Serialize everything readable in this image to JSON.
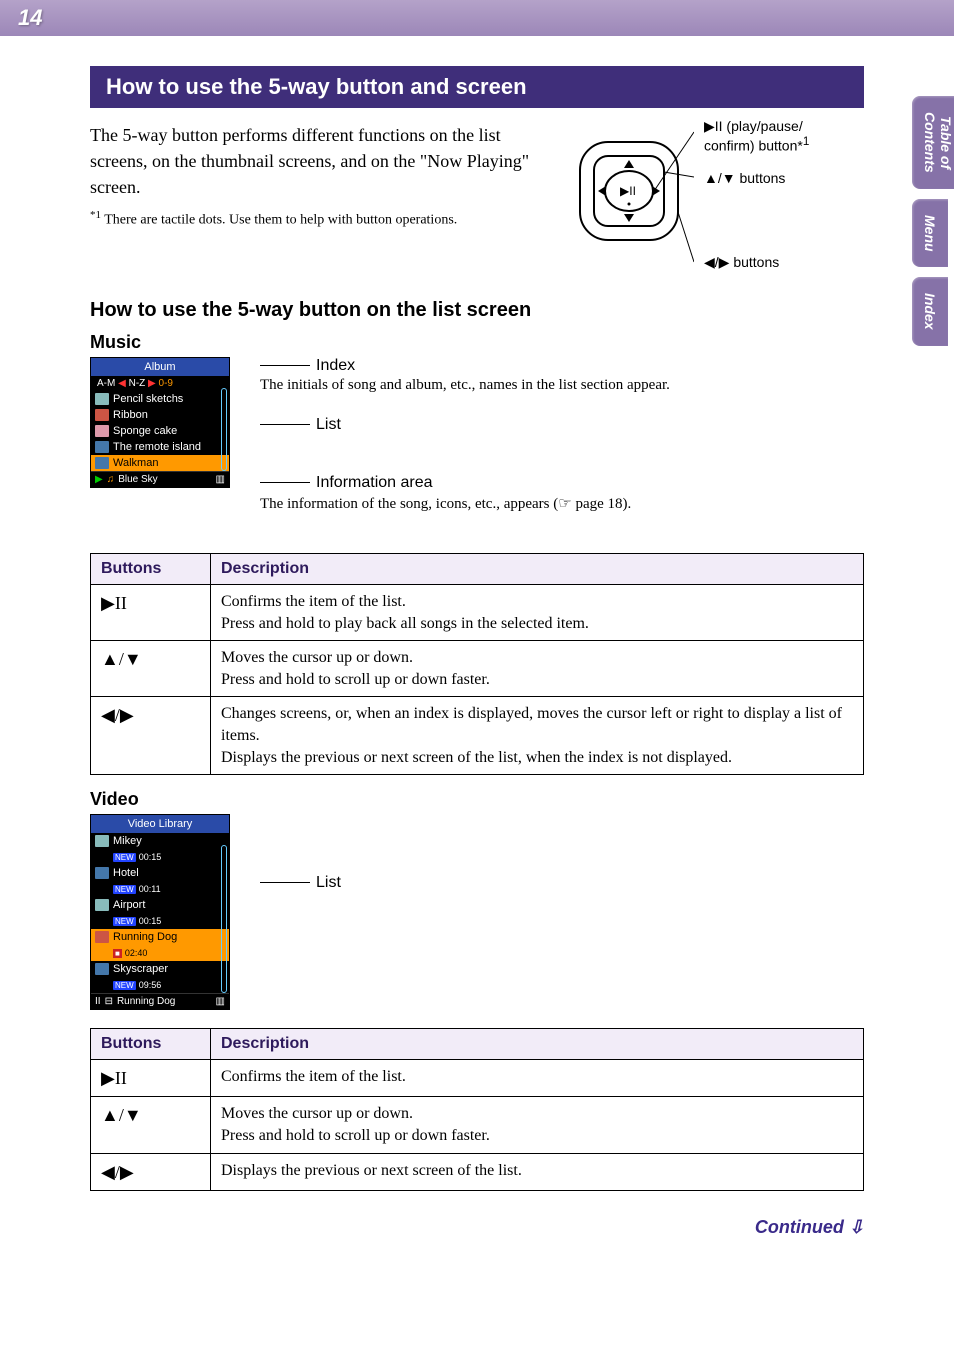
{
  "page_number": "14",
  "side_tabs": {
    "toc": "Table of\nContents",
    "menu": "Menu",
    "index": "Index"
  },
  "section_title": "How to use the 5-way button and screen",
  "intro_para": "The 5-way button performs different functions on the list screens, on the thumbnail screens, and on the \"Now Playing\" screen.",
  "footnote_marker": "*1",
  "footnote_text": "There are tactile dots. Use them to help with button operations.",
  "diagram": {
    "label_playpause_line1": "▶II (play/pause/",
    "label_playpause_line2": "confirm) button*",
    "label_playpause_sup": "1",
    "label_updown": "▲/▼ buttons",
    "label_leftright": "◀/▶ buttons"
  },
  "subhead": "How to use the 5-way button on the list screen",
  "music": {
    "heading": "Music",
    "screen_title": "Album",
    "index_left": "A-M",
    "index_mid": "N-Z",
    "index_right": "0-9",
    "items": [
      "Pencil sketchs",
      "Ribbon",
      "Sponge cake",
      "The remote island",
      "Walkman"
    ],
    "info_line": "Blue Sky",
    "callouts": {
      "index_label": "Index",
      "index_desc": "The initials of song and album, etc., names in the list section appear.",
      "list_label": "List",
      "info_label": "Information area",
      "info_desc": "The information of the song, icons, etc., appears (☞ page 18)."
    }
  },
  "table_headers": {
    "buttons": "Buttons",
    "description": "Description"
  },
  "music_table": [
    {
      "btn": "▶II",
      "desc": "Confirms the item of the list.\nPress and hold to play back all songs in the selected item."
    },
    {
      "btn": "▲/▼",
      "desc": "Moves the cursor up or down.\nPress and hold to scroll up or down faster."
    },
    {
      "btn": "◀/▶",
      "desc": "Changes screens, or, when an index is displayed, moves the cursor left or right to display a list of items.\nDisplays the previous or next screen of the list, when the index is not displayed."
    }
  ],
  "video": {
    "heading": "Video",
    "screen_title": "Video Library",
    "items": [
      {
        "name": "Mikey",
        "dur": "00:15"
      },
      {
        "name": "Hotel",
        "dur": "00:11"
      },
      {
        "name": "Airport",
        "dur": "00:15"
      },
      {
        "name": "Running Dog",
        "dur": "02:40",
        "sel": true
      },
      {
        "name": "Skyscraper",
        "dur": "09:56"
      }
    ],
    "info_line": "Running Dog",
    "callout_list": "List"
  },
  "video_table": [
    {
      "btn": "▶II",
      "desc": "Confirms the item of the list."
    },
    {
      "btn": "▲/▼",
      "desc": "Moves the cursor up or down.\nPress and hold to scroll up or down faster."
    },
    {
      "btn": "◀/▶",
      "desc": "Displays the previous or next screen of the list."
    }
  ],
  "continued": "Continued ⇩"
}
